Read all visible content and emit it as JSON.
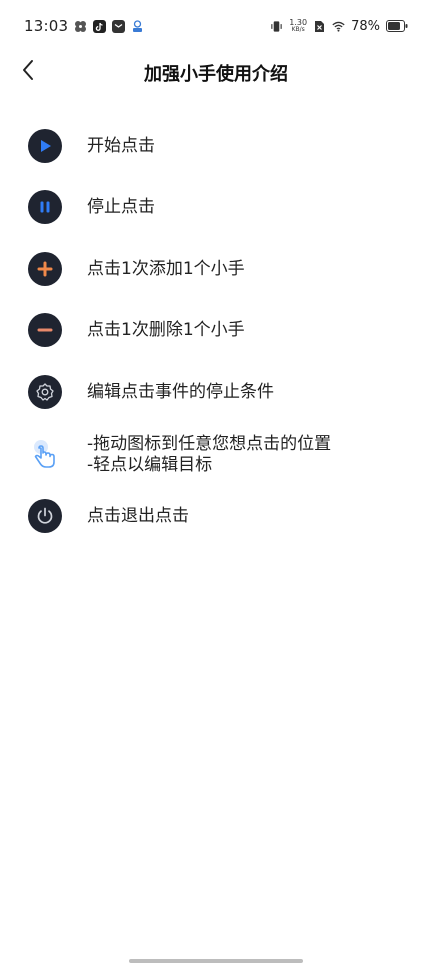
{
  "status_bar": {
    "time": "13:03",
    "net_speed_value": "1.30",
    "net_speed_unit": "KB/s",
    "battery": "78%"
  },
  "header": {
    "title": "加强小手使用介绍"
  },
  "items": [
    {
      "label": "开始点击",
      "icon": "play-icon"
    },
    {
      "label": "停止点击",
      "icon": "pause-icon"
    },
    {
      "label": "点击1次添加1个小手",
      "icon": "plus-icon"
    },
    {
      "label": "点击1次删除1个小手",
      "icon": "minus-icon"
    },
    {
      "label": "编辑点击事件的停止条件",
      "icon": "gear-icon"
    },
    {
      "lines": [
        "-拖动图标到任意您想点击的位置",
        "-轻点以编辑目标"
      ],
      "icon": "hand-pointer-icon"
    },
    {
      "label": "点击退出点击",
      "icon": "power-icon"
    }
  ],
  "colors": {
    "icon_bg": "#1f2430",
    "play_blue": "#2f7cf6",
    "plus_orange": "#f0894a",
    "minus_salmon": "#e98a6b",
    "hand_blue": "#5aa0f5"
  }
}
